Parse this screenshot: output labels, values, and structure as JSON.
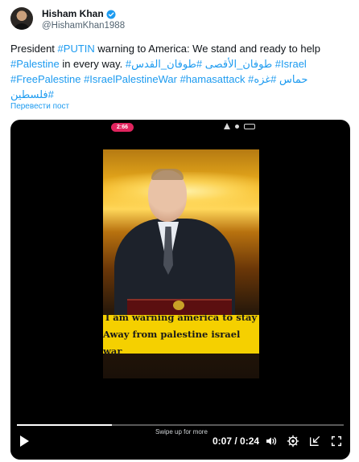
{
  "author": {
    "name": "Hisham Khan",
    "handle": "@HishamKhan1988",
    "verified_color": "#1d9bf0"
  },
  "tweet": {
    "segments": [
      {
        "text": "President ",
        "tag": false
      },
      {
        "text": "#PUTIN",
        "tag": true
      },
      {
        "text": " warning to America: We stand and ready to help ",
        "tag": false
      },
      {
        "text": "#Palestine",
        "tag": true
      },
      {
        "text": " in every way. ",
        "tag": false
      },
      {
        "text": "#طوفان_الأقصى",
        "tag": true
      },
      {
        "text": " ",
        "tag": false
      },
      {
        "text": "#طوفان_القدس",
        "tag": true
      },
      {
        "text": " ",
        "tag": false
      },
      {
        "text": "#Israel",
        "tag": true
      },
      {
        "text": " ",
        "tag": false
      },
      {
        "text": "#FreePalestine",
        "tag": true
      },
      {
        "text": " ",
        "tag": false
      },
      {
        "text": "#IsraelPalestineWar",
        "tag": true
      },
      {
        "text": " ",
        "tag": false
      },
      {
        "text": "#hamasattack",
        "tag": true
      },
      {
        "text": " ",
        "tag": false
      },
      {
        "text": "#حماس",
        "tag": true
      },
      {
        "text": " ",
        "tag": false
      },
      {
        "text": "#غزه",
        "tag": true
      },
      {
        "text": " ",
        "tag": false
      },
      {
        "text": "#فلسطين",
        "tag": true
      }
    ],
    "translate_label": "Перевести пост"
  },
  "video": {
    "status_time": "2:66",
    "caption_line1": "I am warning america to stay",
    "caption_line2": "Away from palestine israel war",
    "caption_bg": "#f5d000",
    "swipe_hint": "Swipe up for more",
    "time": "0:07 / 0:24",
    "progress": 0.29,
    "icons": [
      "play-icon",
      "volume-icon",
      "settings-icon",
      "exit-pip-icon",
      "fullscreen-icon"
    ]
  }
}
